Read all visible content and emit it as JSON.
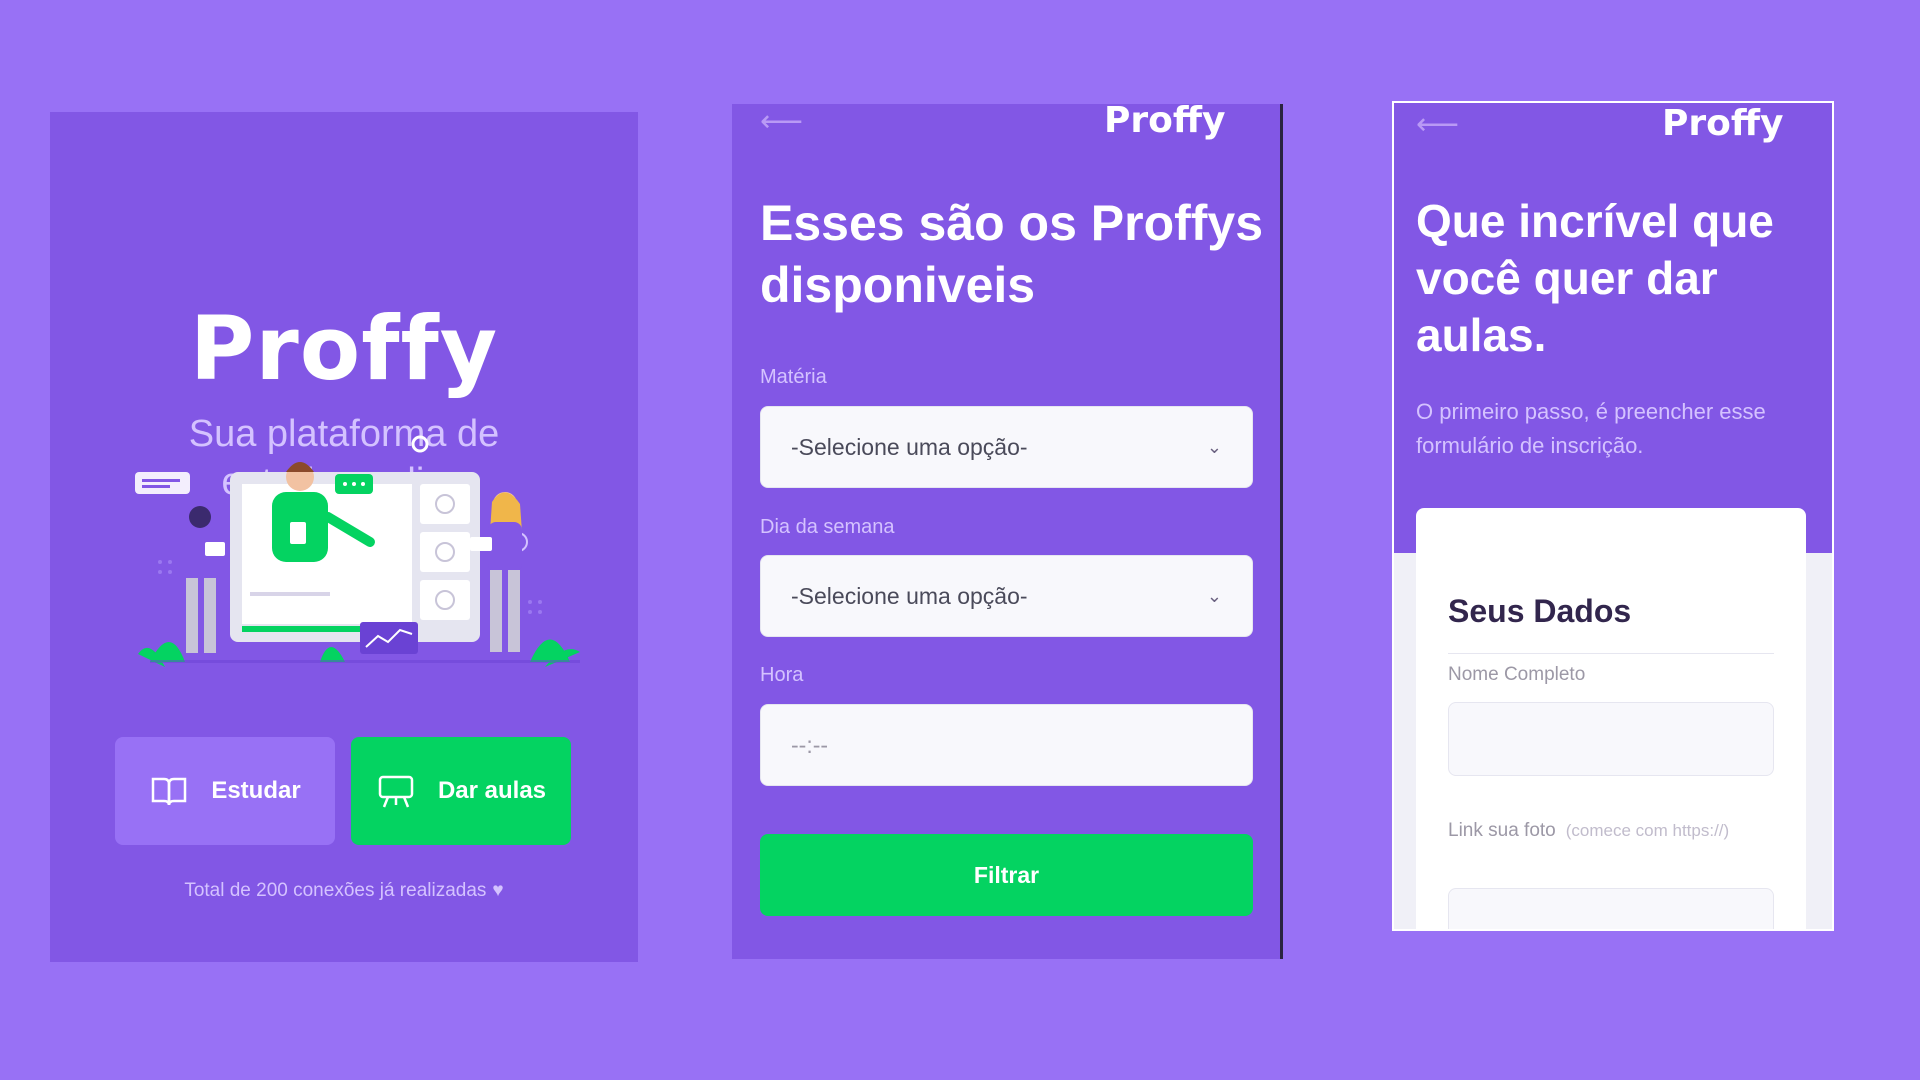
{
  "landing": {
    "logo": "Proffy",
    "tagline": "Sua plataforma de estudos online",
    "study_button": "Estudar",
    "teach_button": "Dar aulas",
    "connections_text": "Total de 200 conexões já realizadas",
    "icons": [
      "book-open-icon",
      "presentation-icon",
      "heart-icon"
    ]
  },
  "teacher_list": {
    "back_arrow": "⟵",
    "logo": "Proffy",
    "title": "Esses são os Proffys disponiveis",
    "fields": [
      {
        "label": "Matéria",
        "value": "-Selecione uma opção-"
      },
      {
        "label": "Dia da semana",
        "value": "-Selecione uma opção-"
      },
      {
        "label": "Hora",
        "value": "--:--"
      }
    ],
    "filter_button": "Filtrar"
  },
  "give_classes": {
    "back_arrow": "⟵",
    "logo": "Proffy",
    "title": "Que incrível que você quer dar aulas.",
    "intro": "O primeiro passo, é preencher esse formulário de inscrição.",
    "section_title": "Seus Dados",
    "name_label": "Nome Completo",
    "photo_label": "Link sua foto",
    "photo_hint": "(comece com https://)"
  },
  "colors": {
    "background": "#9871f5",
    "primary": "#8257e5",
    "primary_light": "#9871f5",
    "secondary": "#04d361",
    "text_light": "#d4c2ff"
  }
}
